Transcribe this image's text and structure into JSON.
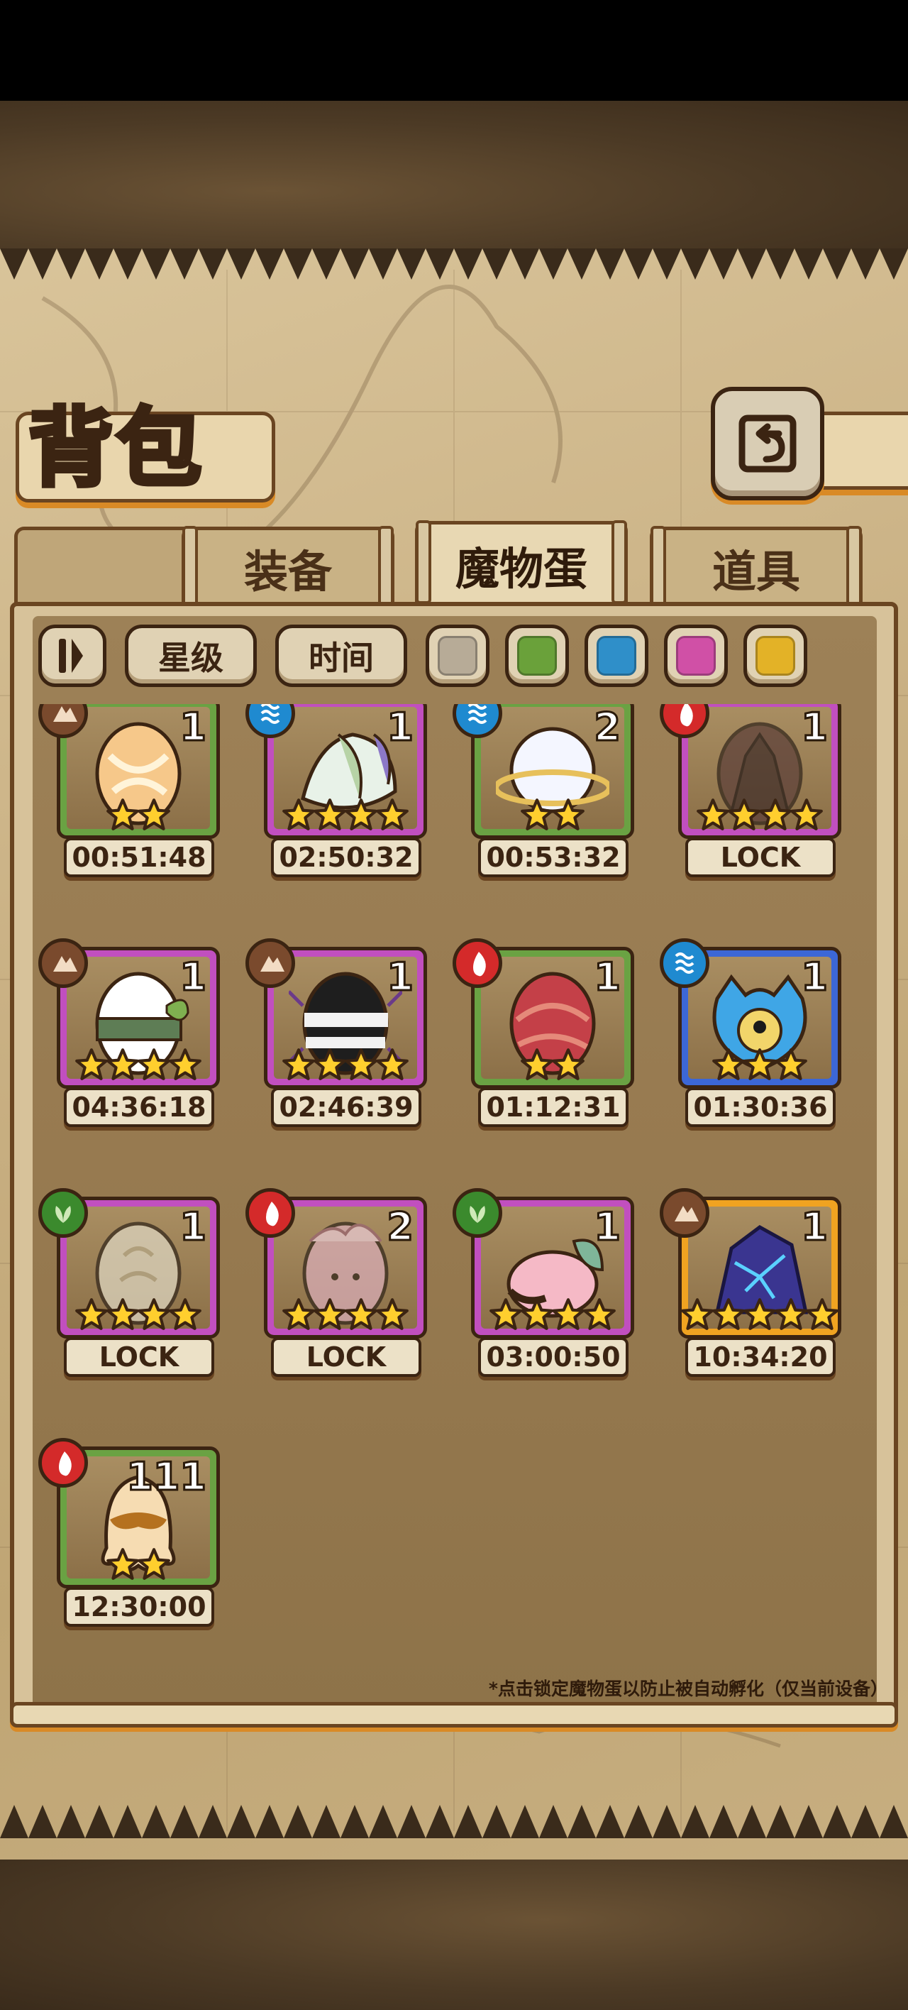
{
  "header": {
    "title": "背包",
    "back_icon": "return-icon"
  },
  "tabs": [
    {
      "label": "装备",
      "active": false
    },
    {
      "label": "魔物蛋",
      "active": true
    },
    {
      "label": "道具",
      "active": false
    }
  ],
  "filters": {
    "sort_icon": "sort-toggle-icon",
    "star_label": "星级",
    "time_label": "时间",
    "colors": [
      "#b7ab97",
      "#6aa13a",
      "#2f8fc9",
      "#d050a6",
      "#e3b227"
    ]
  },
  "eggs": [
    {
      "count": "1",
      "stars": 2,
      "timer": "00:51:48",
      "frame": "green",
      "element": "earth",
      "art": "cream-swirl"
    },
    {
      "count": "1",
      "stars": 4,
      "timer": "02:50:32",
      "frame": "purple",
      "element": "water",
      "art": "leaf-wing"
    },
    {
      "count": "2",
      "stars": 2,
      "timer": "00:53:32",
      "frame": "green",
      "element": "water",
      "art": "cloud-ring"
    },
    {
      "count": "1",
      "stars": 4,
      "timer": "LOCK",
      "frame": "purple",
      "element": "fire",
      "art": "dark-spike"
    },
    {
      "count": "1",
      "stars": 4,
      "timer": "04:36:18",
      "frame": "purple",
      "element": "earth",
      "art": "bandage-leaf"
    },
    {
      "count": "1",
      "stars": 4,
      "timer": "02:46:39",
      "frame": "purple",
      "element": "earth",
      "art": "spider-stripe"
    },
    {
      "count": "1",
      "stars": 2,
      "timer": "01:12:31",
      "frame": "green",
      "element": "fire",
      "art": "red-swirl"
    },
    {
      "count": "1",
      "stars": 3,
      "timer": "01:30:36",
      "frame": "blue",
      "element": "water",
      "art": "blue-eye"
    },
    {
      "count": "1",
      "stars": 4,
      "timer": "LOCK",
      "frame": "purple",
      "element": "grass",
      "art": "pale-shell"
    },
    {
      "count": "2",
      "stars": 4,
      "timer": "LOCK",
      "frame": "purple",
      "element": "fire",
      "art": "pink-flame"
    },
    {
      "count": "1",
      "stars": 4,
      "timer": "03:00:50",
      "frame": "purple",
      "element": "grass",
      "art": "pink-leaf"
    },
    {
      "count": "1",
      "stars": 5,
      "timer": "10:34:20",
      "frame": "orange",
      "element": "earth",
      "art": "crystal-dark"
    },
    {
      "count": "111",
      "stars": 2,
      "timer": "12:30:00",
      "frame": "green",
      "element": "fire",
      "art": "caramel-drip"
    }
  ],
  "footnote": "*点击锁定魔物蛋以防止被自动孵化（仅当前设备）"
}
